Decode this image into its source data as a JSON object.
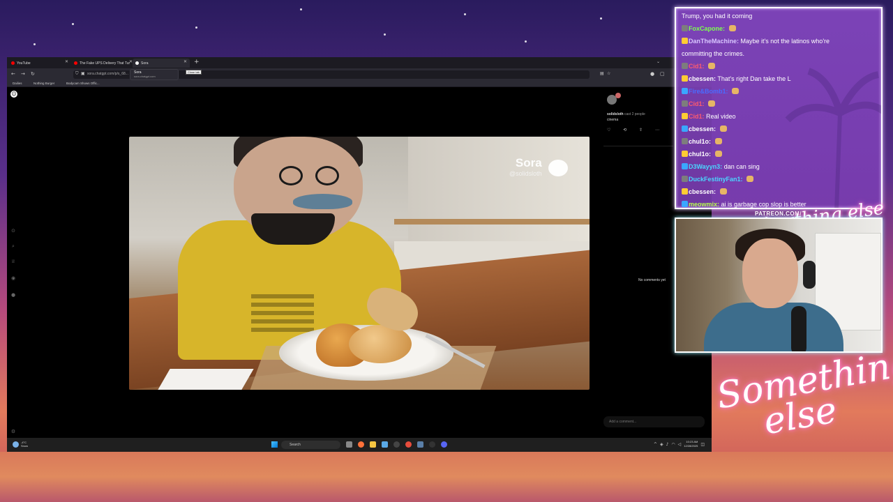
{
  "browser": {
    "tabs": [
      {
        "title": "YouTube",
        "color": "#ff0000"
      },
      {
        "title": "The Fake UPS Delivery That Tur",
        "color": "#ff0000"
      },
      {
        "title": "Sora",
        "color": "#ffffff"
      }
    ],
    "tooltip": {
      "title": "Sora",
      "subtitle": "sora.chatgpt.com"
    },
    "close_tab_tooltip": "Close tab",
    "url": "sora.chatgpt.com/p/s_68...",
    "bookmarks": [
      "Dailies",
      "Nothing Burger",
      "Bodycam Shows Offic..."
    ]
  },
  "video": {
    "watermark_brand": "Sora",
    "watermark_handle": "@solidsloth"
  },
  "post": {
    "username": "solidsloth",
    "cast_text": "cast 2 people",
    "category": "cinema",
    "no_comments": "No comments yet",
    "add_comment_placeholder": "Add a comment..."
  },
  "taskbar": {
    "weather_temp": "-4°C",
    "weather_desc": "Snow",
    "search_placeholder": "Search",
    "time": "10:23 AM",
    "date": "12/28/2025"
  },
  "chat": {
    "messages": [
      {
        "name": "",
        "name_color": "#ffffff",
        "text": "Trump, you had it coming"
      },
      {
        "name": "FoxCapone:",
        "name_color": "#7cff4f",
        "text": ""
      },
      {
        "name": "DanTheMachine:",
        "name_color": "#d8c6ff",
        "text": "Maybe it's not the latinos who're"
      },
      {
        "name": "",
        "name_color": "#ffffff",
        "text": "committing the crimes."
      },
      {
        "name": "Cid1:",
        "name_color": "#ff5a6e",
        "text": ""
      },
      {
        "name": "cbessen:",
        "name_color": "#ffffff",
        "text": "That's right Dan take the L"
      },
      {
        "name": "Fire&Bomb1:",
        "name_color": "#4a6cff",
        "text": ""
      },
      {
        "name": "Cid1:",
        "name_color": "#ff5a6e",
        "text": ""
      },
      {
        "name": "Cid1:",
        "name_color": "#ff5a6e",
        "text": "Real video"
      },
      {
        "name": "cbessen:",
        "name_color": "#ffffff",
        "text": ""
      },
      {
        "name": "chul1o:",
        "name_color": "#ffffff",
        "text": ""
      },
      {
        "name": "chul1o:",
        "name_color": "#ffffff",
        "text": ""
      },
      {
        "name": "D3Wayyn3:",
        "name_color": "#4ad7ff",
        "text": "dan can sing"
      },
      {
        "name": "DuckFestinyFan1:",
        "name_color": "#4ad7ff",
        "text": ""
      },
      {
        "name": "cbessen:",
        "name_color": "#ffffff",
        "text": ""
      },
      {
        "name": "meowmix:",
        "name_color": "#b8ff4f",
        "text": "ai is garbage cop slop is better"
      }
    ]
  },
  "overlay": {
    "patreon": "PATREON.COM/",
    "patreon_script": "Anything else",
    "logo_line1": "Something",
    "logo_line2": "else"
  }
}
